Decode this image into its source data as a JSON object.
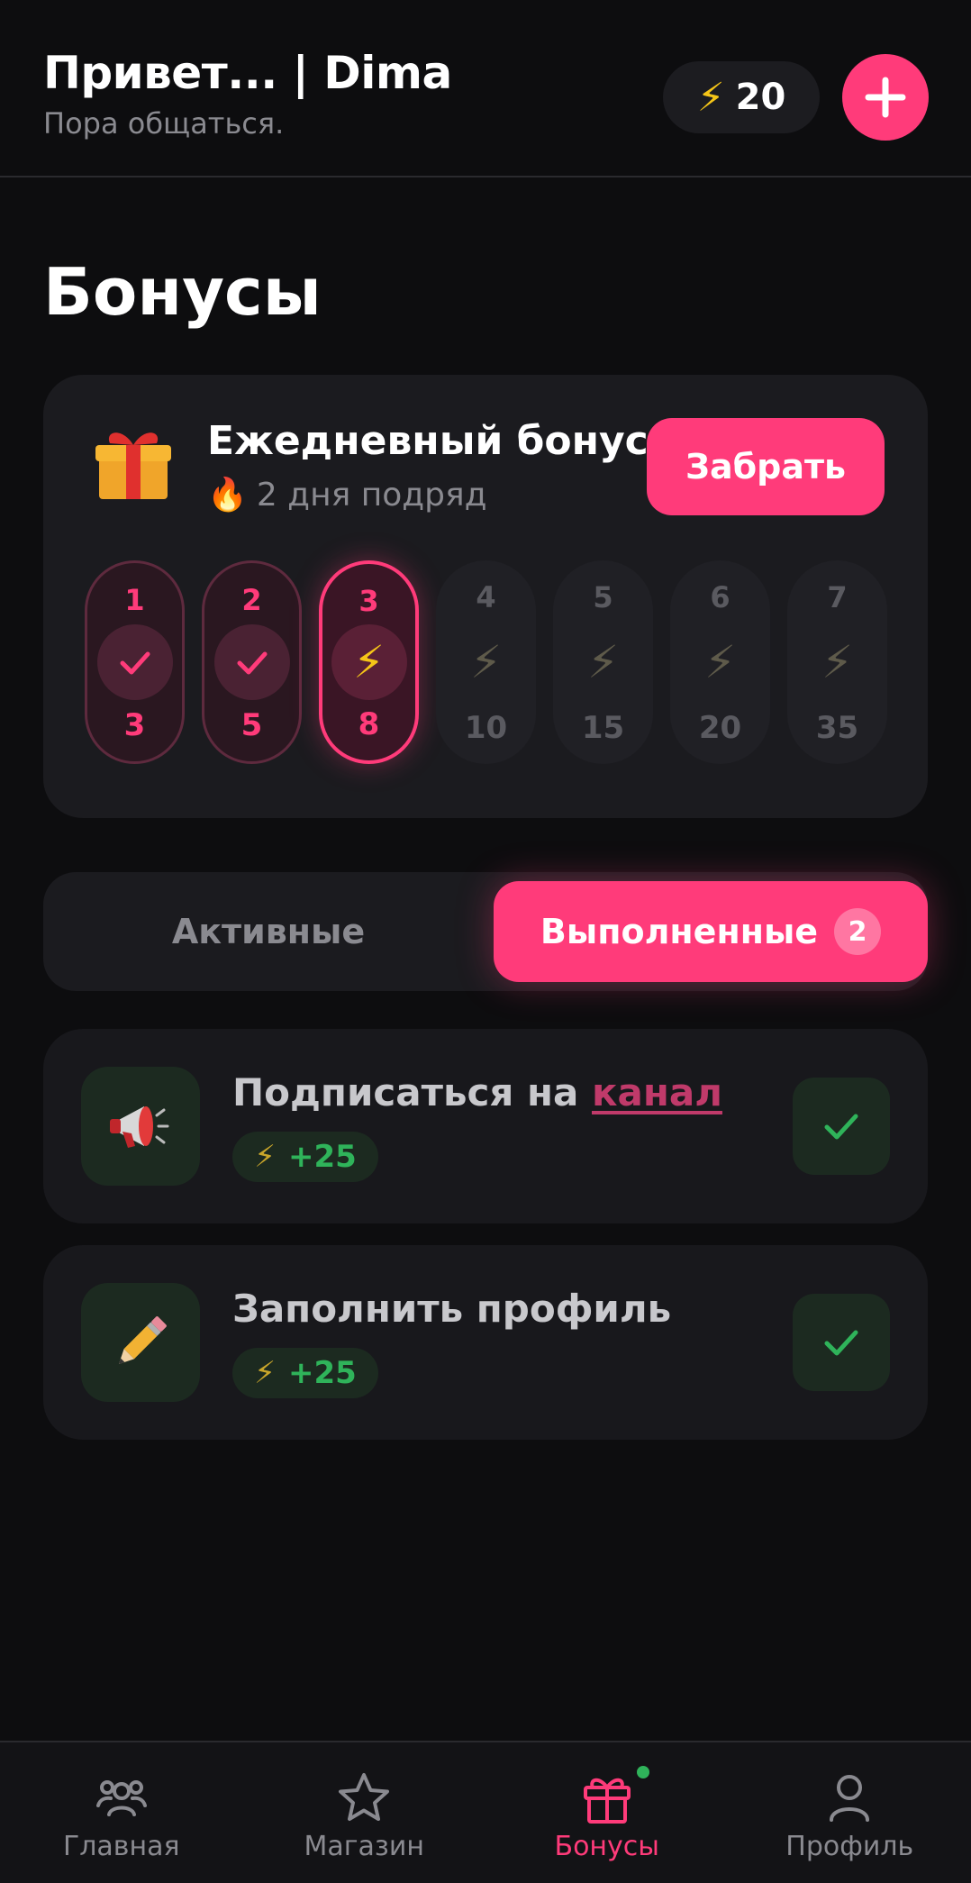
{
  "header": {
    "greeting": "Привет... | Dima",
    "subtitle": "Пора общаться.",
    "balance": "20",
    "balance_icon": "lightning-icon",
    "add_icon": "plus-icon"
  },
  "page": {
    "title": "Бонусы"
  },
  "daily_bonus": {
    "title": "Ежедневный бонус",
    "streak_icon": "fire-icon",
    "streak_text": "2 дня подряд",
    "claim_label": "Забрать",
    "days": [
      {
        "day": "1",
        "reward": "3",
        "state": "claimed"
      },
      {
        "day": "2",
        "reward": "5",
        "state": "claimed"
      },
      {
        "day": "3",
        "reward": "8",
        "state": "current"
      },
      {
        "day": "4",
        "reward": "10",
        "state": "locked"
      },
      {
        "day": "5",
        "reward": "15",
        "state": "locked"
      },
      {
        "day": "6",
        "reward": "20",
        "state": "locked"
      },
      {
        "day": "7",
        "reward": "35",
        "state": "locked"
      }
    ]
  },
  "tabs": {
    "active_label": "Активные",
    "done_label": "Выполненные",
    "done_count": "2",
    "selected": "done"
  },
  "tasks": [
    {
      "title_prefix": "Подписаться на ",
      "title_link": "канал",
      "reward": "+25",
      "icon": "megaphone-icon",
      "status": "completed"
    },
    {
      "title_prefix": "Заполнить профиль",
      "title_link": "",
      "reward": "+25",
      "icon": "pencil-icon",
      "status": "completed"
    }
  ],
  "nav": [
    {
      "label": "Главная",
      "icon": "people-icon"
    },
    {
      "label": "Магазин",
      "icon": "star-icon"
    },
    {
      "label": "Бонусы",
      "icon": "gift-icon",
      "active": true
    },
    {
      "label": "Профиль",
      "icon": "user-icon"
    }
  ],
  "colors": {
    "accent": "#ff3b7a",
    "success": "#2fb35a",
    "bolt": "#f5c518",
    "background": "#0d0d0f"
  }
}
